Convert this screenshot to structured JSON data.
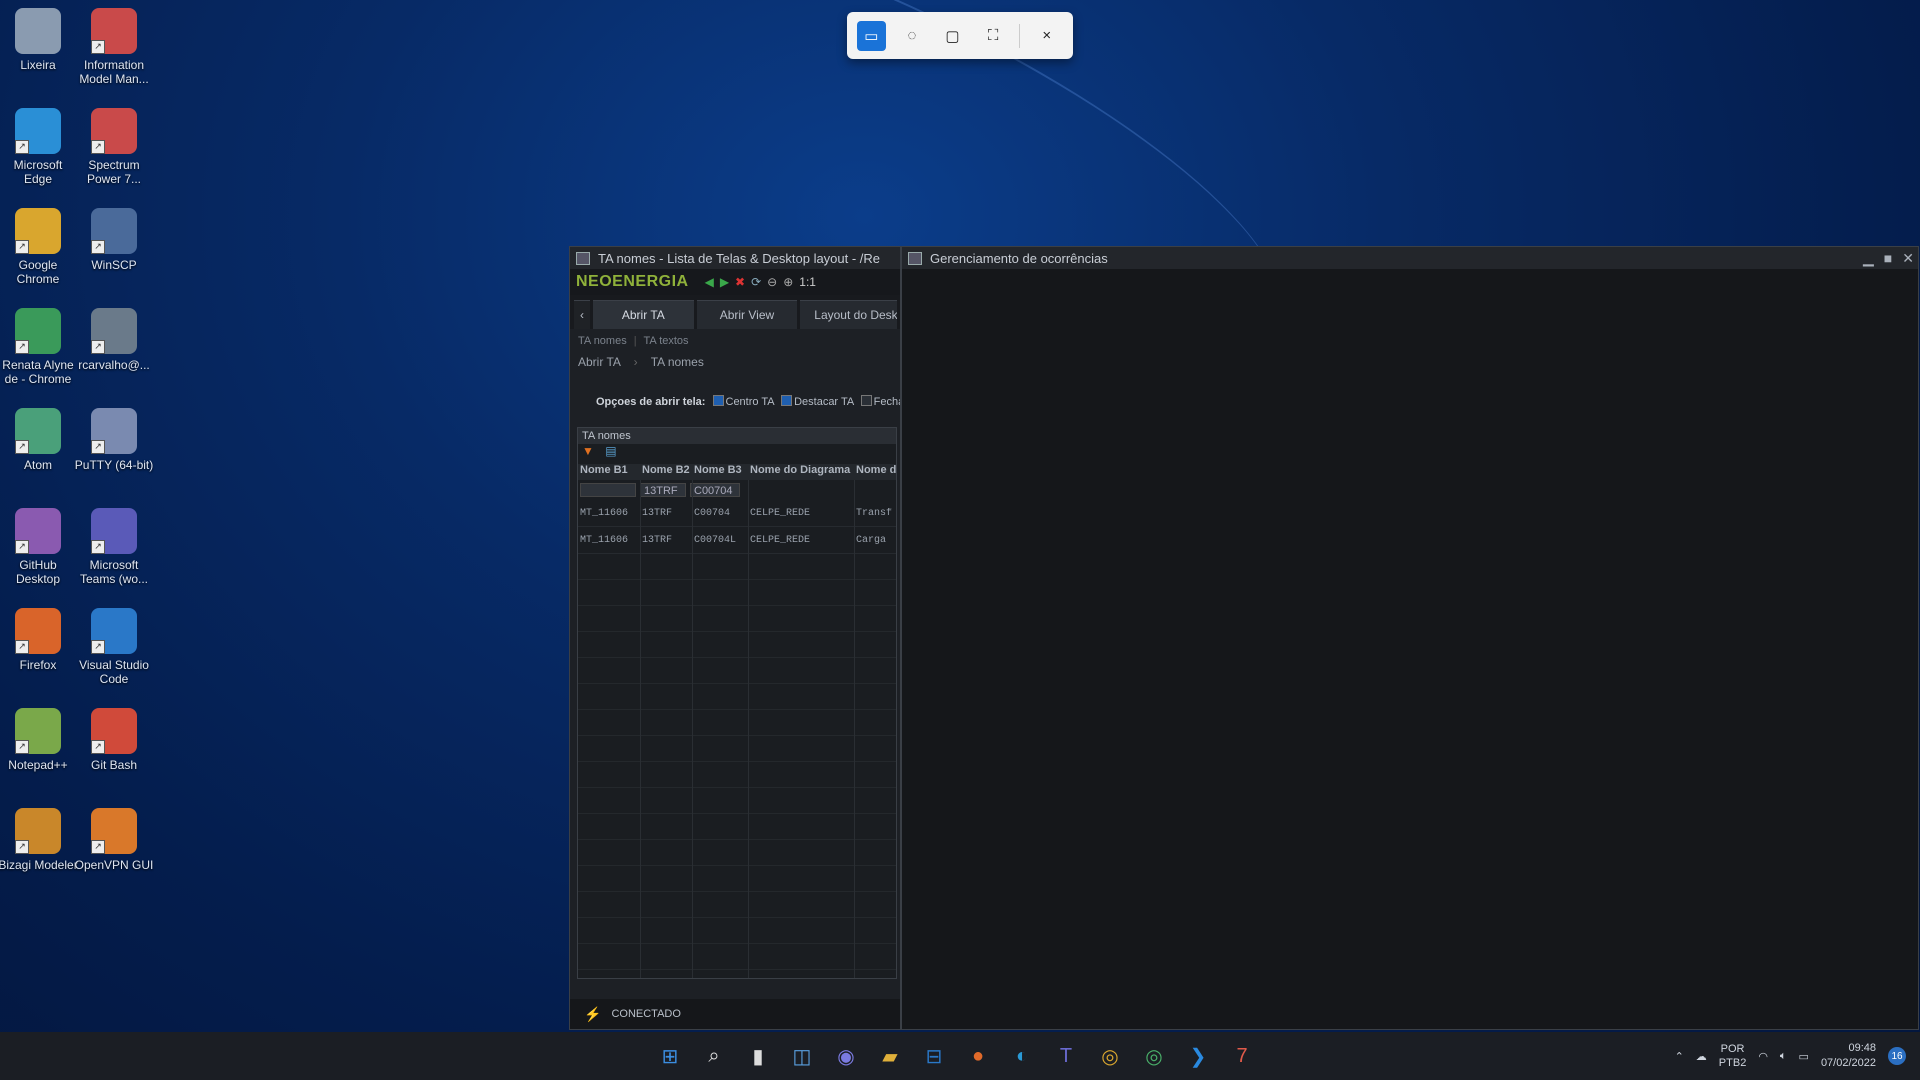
{
  "desktop": {
    "icons": [
      {
        "label": "Lixeira",
        "icon": "recycle-bin-icon"
      },
      {
        "label": "Information Model Man...",
        "icon": "spectrum-7-icon"
      },
      {
        "label": "Microsoft Edge",
        "icon": "edge-icon"
      },
      {
        "label": "Spectrum Power 7...",
        "icon": "spectrum-7-icon"
      },
      {
        "label": "Google Chrome",
        "icon": "chrome-icon"
      },
      {
        "label": "WinSCP",
        "icon": "winscp-icon"
      },
      {
        "label": "Renata Alyne de - Chrome",
        "icon": "chrome-profile-icon"
      },
      {
        "label": "rcarvalho@...",
        "icon": "remote-desktop-icon"
      },
      {
        "label": "Atom",
        "icon": "atom-icon"
      },
      {
        "label": "PuTTY (64-bit)",
        "icon": "putty-icon"
      },
      {
        "label": "GitHub Desktop",
        "icon": "github-icon"
      },
      {
        "label": "Microsoft Teams (wo...",
        "icon": "teams-icon"
      },
      {
        "label": "Firefox",
        "icon": "firefox-icon"
      },
      {
        "label": "Visual Studio Code",
        "icon": "vscode-icon"
      },
      {
        "label": "Notepad++",
        "icon": "notepadpp-icon"
      },
      {
        "label": "Git Bash",
        "icon": "git-bash-icon"
      },
      {
        "label": "Bizagi Modeler",
        "icon": "bizagi-icon"
      },
      {
        "label": "OpenVPN GUI",
        "icon": "openvpn-icon"
      }
    ]
  },
  "snip_toolbar": {
    "modes": [
      "rectangle-snip",
      "freeform-snip",
      "window-snip",
      "fullscreen-snip"
    ],
    "close": "×"
  },
  "ta_window": {
    "title": "TA nomes - Lista de Telas & Desktop layout - /Re",
    "brand": "NEOENERGIA",
    "zoom": "1:1",
    "tabs": [
      "Abrir TA",
      "Abrir View",
      "Layout do Desk"
    ],
    "subtabs": [
      "TA nomes",
      "TA textos"
    ],
    "breadcrumb": [
      "Abrir TA",
      "TA nomes"
    ],
    "options": {
      "label": "Opçoes de abrir tela:",
      "centro": "Centro TA",
      "destacar": "Destacar TA",
      "fechar": "Fechar"
    },
    "grid": {
      "title": "TA nomes",
      "headers": [
        "Nome B1",
        "Nome B2",
        "Nome B3",
        "Nome do Diagrama",
        "Nome da"
      ],
      "filters": [
        "",
        "13TRF",
        "C00704"
      ],
      "rows": [
        [
          "MT_11606",
          "13TRF",
          "C00704",
          "CELPE_REDE",
          "Transf"
        ],
        [
          "MT_11606",
          "13TRF",
          "C00704L",
          "CELPE_REDE",
          "Carga"
        ]
      ]
    },
    "status": "CONECTADO"
  },
  "occ_window": {
    "title": "Gerenciamento de ocorrências"
  },
  "taskbar": {
    "apps": [
      "start-icon",
      "search-icon",
      "taskview-icon",
      "widgets-icon",
      "chat-icon",
      "file-explorer-icon",
      "remote-icon",
      "firefox-icon",
      "edge-icon",
      "teams-icon",
      "chrome-icon",
      "chrome-alt-icon",
      "vscode-icon",
      "spectrum-7-icon"
    ],
    "lang_top": "POR",
    "lang_bottom": "PTB2",
    "time": "09:48",
    "date": "07/02/2022",
    "notifications": "16"
  }
}
